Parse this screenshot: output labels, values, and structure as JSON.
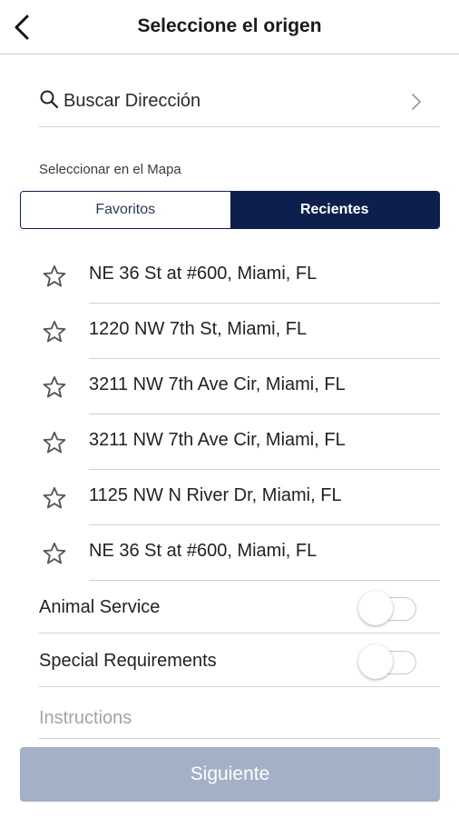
{
  "header": {
    "title": "Seleccione el origen",
    "back_icon": "chevron-left-icon"
  },
  "search": {
    "placeholder": "Buscar Dirección",
    "icon": "search-icon",
    "trailing_icon": "chevron-right-icon"
  },
  "map_select_label": "Seleccionar en el Mapa",
  "segments": {
    "favorites": "Favoritos",
    "recents": "Recientes",
    "active": "recents"
  },
  "recent_addresses": [
    {
      "address": "NE 36 St at #600, Miami, FL",
      "icon": "star-outline-icon"
    },
    {
      "address": "1220 NW 7th St, Miami, FL",
      "icon": "star-outline-icon"
    },
    {
      "address": "3211 NW 7th Ave Cir, Miami, FL",
      "icon": "star-outline-icon"
    },
    {
      "address": "3211 NW 7th Ave Cir, Miami, FL",
      "icon": "star-outline-icon"
    },
    {
      "address": "1125 NW N River Dr, Miami, FL",
      "icon": "star-outline-icon"
    },
    {
      "address": "NE 36 St at #600, Miami, FL",
      "icon": "star-outline-icon"
    }
  ],
  "options": {
    "animal_service": {
      "label": "Animal Service",
      "enabled": false
    },
    "special_requirements": {
      "label": "Special Requirements",
      "enabled": false
    }
  },
  "instructions": {
    "placeholder": "Instructions",
    "value": ""
  },
  "next_button": {
    "label": "Siguiente",
    "disabled": true
  },
  "colors": {
    "primary": "#0d1f4c",
    "button_disabled": "#a3b0c6",
    "divider": "#cfcfcf",
    "placeholder": "#a3a3a3"
  }
}
